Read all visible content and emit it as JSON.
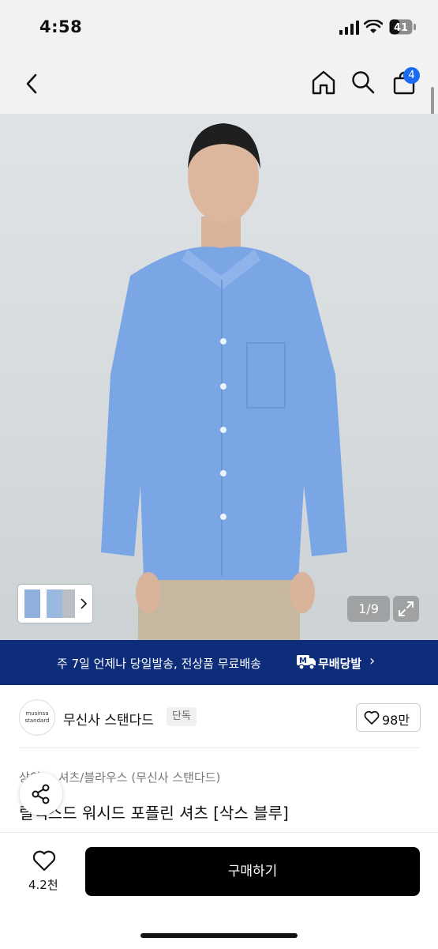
{
  "status": {
    "time": "4:58",
    "battery": "41"
  },
  "header": {
    "cart_count": "4"
  },
  "gallery": {
    "counter": "1/9"
  },
  "banner": {
    "text": "주 7일 언제나 당일발송, 전상품 무료배송",
    "service": "무배당발"
  },
  "brand": {
    "logo_line1": "musinsa",
    "logo_line2": "standard",
    "name": "무신사 스탠다드",
    "tag": "단독",
    "like_count": "98만"
  },
  "product": {
    "breadcrumb": "상의 > 셔츠/블라우스 (무신사 스탠다드)",
    "title": "릴렉스드 워시드 포플린 셔츠 [삭스 블루]"
  },
  "bottom": {
    "likes": "4.2천",
    "buy_label": "구매하기"
  },
  "colors": {
    "banner": "#0d2d7a",
    "badge": "#1a6bf0",
    "shirt": "#7aa6e6",
    "pants": "#c6b7a0"
  },
  "icons": [
    "back-icon",
    "home-icon",
    "search-icon",
    "shopping-bag-icon",
    "expand-icon",
    "share-icon",
    "heart-icon",
    "chevron-right-icon"
  ]
}
